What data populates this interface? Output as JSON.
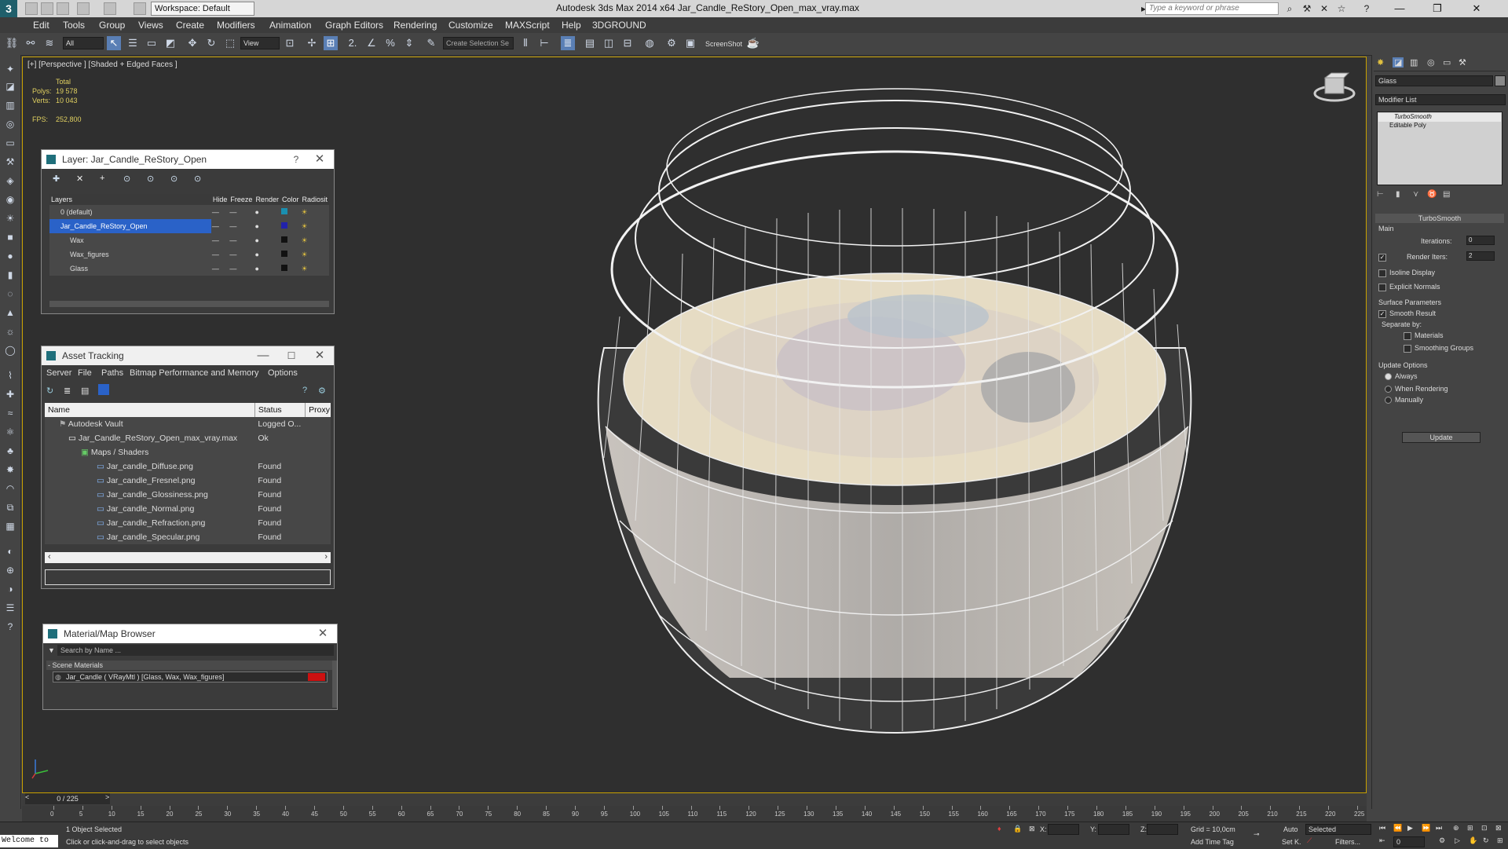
{
  "titlebar": {
    "app_title": "Autodesk 3ds Max  2014 x64     Jar_Candle_ReStory_Open_max_vray.max",
    "workspace": "Workspace: Default",
    "search_placeholder": "Type a keyword or phrase"
  },
  "menu": [
    "Edit",
    "Tools",
    "Group",
    "Views",
    "Create",
    "Modifiers",
    "Animation",
    "Graph Editors",
    "Rendering",
    "Customize",
    "MAXScript",
    "Help",
    "3DGROUND"
  ],
  "toolbar": {
    "filter": "All",
    "ref_coord": "View",
    "selection_set": "Create Selection Se",
    "screenshot": "ScreenShot"
  },
  "viewport": {
    "label": "[+] [Perspective ] [Shaded + Edged Faces ]",
    "stats_total": "Total",
    "polys_label": "Polys:",
    "polys_value": "19 578",
    "verts_label": "Verts:",
    "verts_value": "10 043",
    "fps_label": "FPS:",
    "fps_value": "252,800"
  },
  "layer_panel": {
    "title": "Layer: Jar_Candle_ReStory_Open",
    "help": "?",
    "columns": [
      "Layers",
      "Hide",
      "Freeze",
      "Render",
      "Color",
      "Radiosit"
    ],
    "rows": [
      {
        "name": "0 (default)",
        "color": "#1a8fb0"
      },
      {
        "name": "Jar_Candle_ReStory_Open",
        "color": "#2222aa"
      },
      {
        "name": "Wax",
        "color": "#111111"
      },
      {
        "name": "Wax_figures",
        "color": "#111111"
      },
      {
        "name": "Glass",
        "color": "#111111"
      }
    ]
  },
  "asset_panel": {
    "title": "Asset Tracking",
    "menu": [
      "Server",
      "File",
      "Paths",
      "Bitmap Performance and Memory",
      "Options"
    ],
    "columns": [
      "Name",
      "Status",
      "Proxy"
    ],
    "rows": [
      {
        "name": "Autodesk Vault",
        "status": "Logged O..."
      },
      {
        "name": "Jar_Candle_ReStory_Open_max_vray.max",
        "status": "Ok"
      },
      {
        "name": "Maps / Shaders",
        "status": ""
      },
      {
        "name": "Jar_candle_Diffuse.png",
        "status": "Found"
      },
      {
        "name": "Jar_candle_Fresnel.png",
        "status": "Found"
      },
      {
        "name": "Jar_candle_Glossiness.png",
        "status": "Found"
      },
      {
        "name": "Jar_candle_Normal.png",
        "status": "Found"
      },
      {
        "name": "Jar_candle_Refraction.png",
        "status": "Found"
      },
      {
        "name": "Jar_candle_Specular.png",
        "status": "Found"
      }
    ]
  },
  "material_panel": {
    "title": "Material/Map Browser",
    "search_placeholder": "Search by Name ...",
    "section": "- Scene Materials",
    "item": "Jar_Candle  ( VRayMtl ) [Glass, Wax, Wax_figures]"
  },
  "command_panel": {
    "object_name": "Glass",
    "modifier_list": "Modifier List",
    "stack": [
      "TurboSmooth",
      "Editable Poly"
    ],
    "rollout_title": "TurboSmooth",
    "main": "Main",
    "iterations_label": "Iterations:",
    "iterations_value": "0",
    "render_iters_label": "Render Iters:",
    "render_iters_value": "2",
    "isoline": "Isoline Display",
    "explicit_normals": "Explicit Normals",
    "surface_params": "Surface Parameters",
    "smooth_result": "Smooth Result",
    "separate_by": "Separate by:",
    "materials": "Materials",
    "smoothing_groups": "Smoothing Groups",
    "update_options": "Update Options",
    "always": "Always",
    "when_rendering": "When Rendering",
    "manually": "Manually",
    "update_button": "Update"
  },
  "timeline": {
    "frame": "0 / 225",
    "ticks": [
      "0",
      "5",
      "10",
      "15",
      "20",
      "25",
      "30",
      "35",
      "40",
      "45",
      "50",
      "55",
      "60",
      "65",
      "70",
      "75",
      "80",
      "85",
      "90",
      "95",
      "100",
      "105",
      "110",
      "115",
      "120",
      "125",
      "130",
      "135",
      "140",
      "145",
      "150",
      "155",
      "160",
      "165",
      "170",
      "175",
      "180",
      "185",
      "190",
      "195",
      "200",
      "205",
      "210",
      "215",
      "220",
      "225"
    ]
  },
  "status": {
    "welcome": "Welcome to",
    "selected": "1 Object Selected",
    "prompt": "Click or click-and-drag to select objects",
    "x_label": "X:",
    "y_label": "Y:",
    "z_label": "Z:",
    "grid": "Grid = 10,0cm",
    "add_time_tag": "Add Time Tag",
    "auto": "Auto",
    "set_key": "Set K.",
    "selected_dropdown": "Selected",
    "filters": "Filters...",
    "frame_value": "0"
  }
}
